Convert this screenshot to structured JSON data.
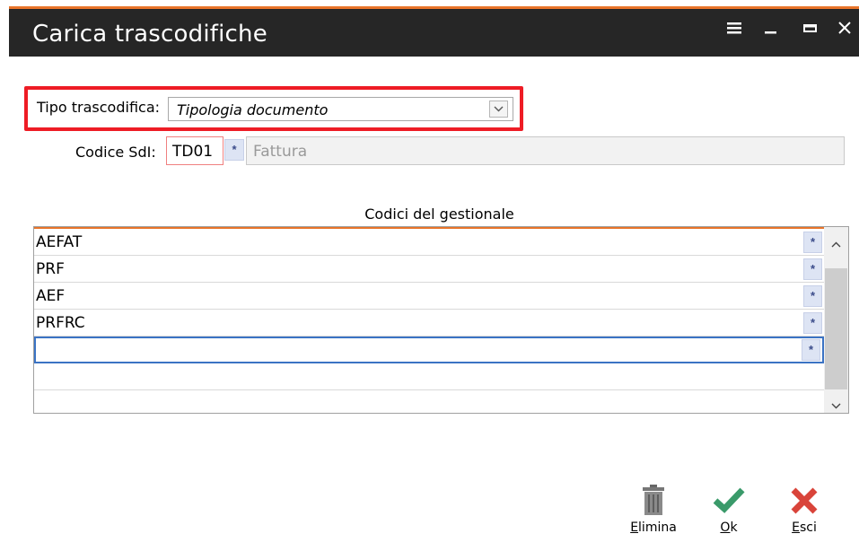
{
  "window": {
    "title": "Carica trascodifiche",
    "controls": [
      "hamburger-menu-icon",
      "minimize-icon",
      "maximize-icon",
      "close-icon"
    ]
  },
  "form": {
    "tipo_label": "Tipo trascodifica:",
    "tipo_value": "Tipologia documento",
    "codice_label": "Codice SdI:",
    "codice_value": "TD01",
    "codice_zoom": "*",
    "codice_desc": "Fattura"
  },
  "grid": {
    "title": "Codici del gestionale",
    "rows": [
      {
        "value": "AEFAT",
        "zoom": "*"
      },
      {
        "value": "PRF",
        "zoom": "*"
      },
      {
        "value": "AEF",
        "zoom": "*"
      },
      {
        "value": "PRFRC",
        "zoom": "*"
      },
      {
        "value": "",
        "zoom": "*"
      }
    ]
  },
  "actions": {
    "elimina": {
      "first": "E",
      "rest": "limina"
    },
    "ok": {
      "first": "O",
      "rest": "k"
    },
    "esci": {
      "first": "E",
      "rest": "sci"
    }
  },
  "colors": {
    "accent": "#e8742a",
    "titlebar": "#262626",
    "highlight": "#ee1c25",
    "ok_green": "#3a9a6a",
    "cancel_red": "#d9443a"
  }
}
